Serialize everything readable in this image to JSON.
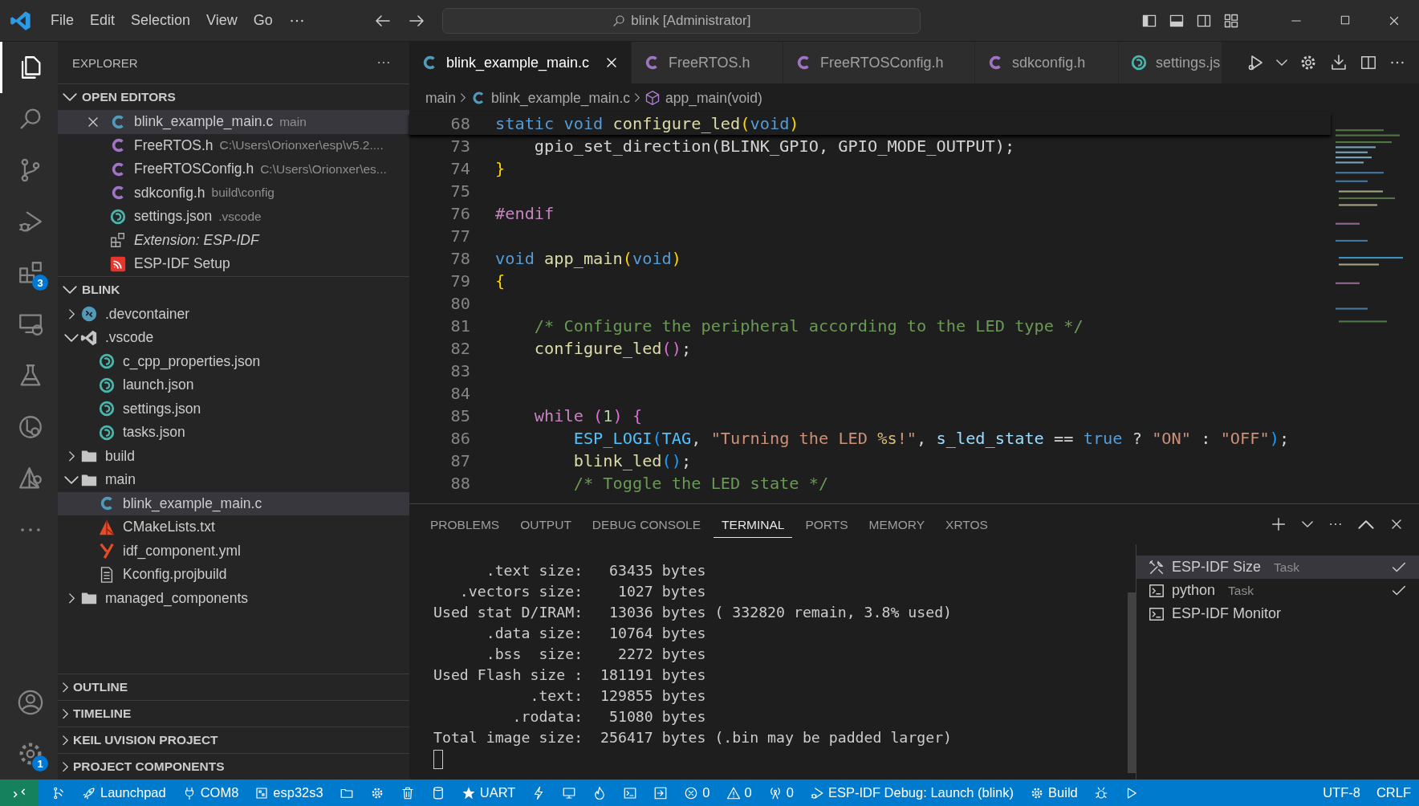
{
  "title_bar": {
    "menu": [
      {
        "label": "File"
      },
      {
        "label": "Edit"
      },
      {
        "label": "Selection"
      },
      {
        "label": "View"
      },
      {
        "label": "Go"
      }
    ],
    "search": {
      "value": "blink [Administrator]"
    }
  },
  "activity_bar": {
    "items": [
      {
        "kind": "files",
        "selected": true
      },
      {
        "kind": "search",
        "selected": false
      },
      {
        "kind": "branch",
        "selected": false
      },
      {
        "kind": "debug",
        "selected": false
      },
      {
        "kind": "extensions",
        "selected": false,
        "badge": "3"
      },
      {
        "kind": "remote",
        "selected": false
      },
      {
        "kind": "flask",
        "selected": false
      },
      {
        "kind": "circle-search",
        "selected": false
      },
      {
        "kind": "pyramid",
        "selected": false
      },
      {
        "kind": "more",
        "selected": false
      }
    ],
    "bottom": [
      {
        "kind": "account"
      },
      {
        "kind": "settings",
        "badge": "1"
      }
    ]
  },
  "sidebar": {
    "title": "EXPLORER",
    "sections": [
      {
        "title": "OPEN EDITORS",
        "expanded": true,
        "items": [
          {
            "name": "blink_example_main.c",
            "detail": "main",
            "kind": "c",
            "selected": true
          },
          {
            "name": "FreeRTOS.h",
            "detail": "C:\\Users\\Orionxer\\esp\\v5.2....",
            "kind": "h",
            "selected": false
          },
          {
            "name": "FreeRTOSConfig.h",
            "detail": "C:\\Users\\Orionxer\\es...",
            "kind": "h",
            "selected": false
          },
          {
            "name": "sdkconfig.h",
            "detail": "build\\config",
            "kind": "h",
            "selected": false
          },
          {
            "name": "settings.json",
            "detail": ".vscode",
            "kind": "json",
            "selected": false
          },
          {
            "name": "Extension: ESP-IDF",
            "kind": "extension",
            "selected": false
          },
          {
            "name": "ESP-IDF Setup",
            "kind": "esp",
            "selected": false
          }
        ]
      },
      {
        "title": "BLINK",
        "expanded": true,
        "items": [
          {
            "name": ".devcontainer",
            "kind": "devcontainer",
            "expanded": false,
            "selected": false
          },
          {
            "name": ".vscode",
            "kind": "vscode",
            "expanded": true,
            "selected": false,
            "children": [
              {
                "name": "c_cpp_properties.json",
                "kind": "json",
                "selected": false
              },
              {
                "name": "launch.json",
                "kind": "json",
                "selected": false
              },
              {
                "name": "settings.json",
                "kind": "json",
                "selected": false
              },
              {
                "name": "tasks.json",
                "kind": "json",
                "selected": false
              }
            ]
          },
          {
            "name": "build",
            "kind": "folder",
            "expanded": false,
            "selected": false
          },
          {
            "name": "main",
            "kind": "folder",
            "expanded": true,
            "selected": false,
            "children": [
              {
                "name": "blink_example_main.c",
                "kind": "c",
                "selected": true
              },
              {
                "name": "CMakeLists.txt",
                "kind": "cmake",
                "selected": false
              },
              {
                "name": "idf_component.yml",
                "kind": "yaml",
                "selected": false
              },
              {
                "name": "Kconfig.projbuild",
                "kind": "file",
                "selected": false
              }
            ]
          },
          {
            "name": "managed_components",
            "kind": "folder",
            "expanded": false,
            "selected": false
          }
        ]
      },
      {
        "title": "OUTLINE",
        "expanded": false
      },
      {
        "title": "TIMELINE",
        "expanded": false
      },
      {
        "title": "KEIL UVISION PROJECT",
        "expanded": false
      },
      {
        "title": "PROJECT COMPONENTS",
        "expanded": false
      }
    ]
  },
  "tabs": [
    {
      "label": "blink_example_main.c",
      "kind": "c",
      "selected": true
    },
    {
      "label": "FreeRTOS.h",
      "kind": "h",
      "selected": false
    },
    {
      "label": "FreeRTOSConfig.h",
      "kind": "h",
      "selected": false
    },
    {
      "label": "sdkconfig.h",
      "kind": "h",
      "selected": false
    },
    {
      "label": "settings.js",
      "kind": "json",
      "selected": false
    }
  ],
  "breadcrumb": [
    {
      "label": "main",
      "kind": "folder"
    },
    {
      "label": "blink_example_main.c",
      "kind": "c"
    },
    {
      "label": "app_main(void)",
      "kind": "symbol"
    }
  ],
  "editor": {
    "sticky": {
      "number": "68",
      "tokens": [
        {
          "kind": "keyword",
          "text": "static void "
        },
        {
          "kind": "function",
          "text": "configure_led"
        },
        {
          "kind": "bracket1",
          "text": "("
        },
        {
          "kind": "keyword",
          "text": "void"
        },
        {
          "kind": "bracket1",
          "text": ")"
        }
      ]
    },
    "lines": [
      {
        "number": "73",
        "tokens": [
          {
            "kind": "plain",
            "text": "    gpio_set_direction(BLINK_GPIO, GPIO_MODE_OUTPUT);"
          }
        ]
      },
      {
        "number": "74",
        "tokens": [
          {
            "kind": "bracket1",
            "text": "}"
          }
        ]
      },
      {
        "number": "75"
      },
      {
        "number": "76",
        "tokens": [
          {
            "kind": "preprocessor",
            "text": "#endif"
          }
        ]
      },
      {
        "number": "77"
      },
      {
        "number": "78",
        "tokens": [
          {
            "kind": "keyword",
            "text": "void "
          },
          {
            "kind": "function",
            "text": "app_main"
          },
          {
            "kind": "bracket1",
            "text": "("
          },
          {
            "kind": "keyword",
            "text": "void"
          },
          {
            "kind": "bracket1",
            "text": ")"
          }
        ]
      },
      {
        "number": "79",
        "tokens": [
          {
            "kind": "bracket1",
            "text": "{"
          }
        ]
      },
      {
        "number": "80"
      },
      {
        "number": "81",
        "tokens": [
          {
            "kind": "comment",
            "text": "    /* Configure the peripheral according to the LED type */"
          }
        ]
      },
      {
        "number": "82",
        "tokens": [
          {
            "kind": "function",
            "text": "    configure_led"
          },
          {
            "kind": "bracket2",
            "text": "()"
          },
          {
            "kind": "plain",
            "text": ";"
          }
        ]
      },
      {
        "number": "83"
      },
      {
        "number": "84"
      },
      {
        "number": "85",
        "tokens": [
          {
            "kind": "control",
            "text": "    while "
          },
          {
            "kind": "bracket2",
            "text": "("
          },
          {
            "kind": "number",
            "text": "1"
          },
          {
            "kind": "bracket2",
            "text": ") {"
          }
        ]
      },
      {
        "number": "86",
        "tokens": [
          {
            "kind": "macro",
            "text": "        ESP_LOGI"
          },
          {
            "kind": "bracket3",
            "text": "("
          },
          {
            "kind": "macro",
            "text": "TAG"
          },
          {
            "kind": "plain",
            "text": ", "
          },
          {
            "kind": "string",
            "text": "\"Turning the LED "
          },
          {
            "kind": "escape",
            "text": "%s"
          },
          {
            "kind": "string",
            "text": "!\""
          },
          {
            "kind": "plain",
            "text": ", "
          },
          {
            "kind": "variable",
            "text": "s_led_state"
          },
          {
            "kind": "plain",
            "text": " == "
          },
          {
            "kind": "keyword",
            "text": "true"
          },
          {
            "kind": "plain",
            "text": " ? "
          },
          {
            "kind": "string",
            "text": "\"ON\""
          },
          {
            "kind": "plain",
            "text": " : "
          },
          {
            "kind": "string",
            "text": "\"OFF\""
          },
          {
            "kind": "bracket3",
            "text": ")"
          },
          {
            "kind": "plain",
            "text": ";"
          }
        ]
      },
      {
        "number": "87",
        "tokens": [
          {
            "kind": "function",
            "text": "        blink_led"
          },
          {
            "kind": "bracket3",
            "text": "()"
          },
          {
            "kind": "plain",
            "text": ";"
          }
        ]
      },
      {
        "number": "88",
        "tokens": [
          {
            "kind": "comment",
            "text": "        /* Toggle the LED state */"
          }
        ]
      }
    ]
  },
  "panel": {
    "tabs": [
      {
        "label": "PROBLEMS",
        "selected": false
      },
      {
        "label": "OUTPUT",
        "selected": false
      },
      {
        "label": "DEBUG CONSOLE",
        "selected": false
      },
      {
        "label": "TERMINAL",
        "selected": true
      },
      {
        "label": "PORTS",
        "selected": false
      },
      {
        "label": "MEMORY",
        "selected": false
      },
      {
        "label": "XRTOS",
        "selected": false
      }
    ],
    "terminal_lines": [
      "      .text size:   63435 bytes",
      "   .vectors size:    1027 bytes",
      "Used stat D/IRAM:   13036 bytes ( 332820 remain, 3.8% used)",
      "      .data size:   10764 bytes",
      "      .bss  size:    2272 bytes",
      "Used Flash size :  181191 bytes",
      "           .text:  129855 bytes",
      "         .rodata:   51080 bytes",
      "Total image size:  256417 bytes (.bin may be padded larger)"
    ],
    "terminals": [
      {
        "name": "ESP-IDF Size",
        "detail": "Task",
        "kind": "tools",
        "done": true,
        "selected": true
      },
      {
        "name": "python",
        "detail": "Task",
        "kind": "terminal",
        "done": true,
        "selected": false
      },
      {
        "name": "ESP-IDF Monitor",
        "kind": "terminal",
        "done": false,
        "selected": false
      }
    ]
  },
  "status_bar": {
    "items": [
      {
        "kind": "fork"
      },
      {
        "kind": "rocket",
        "text": "Launchpad"
      },
      {
        "kind": "plug",
        "text": "COM8"
      },
      {
        "kind": "chip",
        "text": "esp32s3"
      },
      {
        "kind": "folder"
      },
      {
        "kind": "gear"
      },
      {
        "kind": "trash"
      },
      {
        "kind": "database"
      },
      {
        "kind": "star",
        "text": "UART"
      },
      {
        "kind": "bolt"
      },
      {
        "kind": "monitor"
      },
      {
        "kind": "flame"
      },
      {
        "kind": "terminal"
      },
      {
        "kind": "arrow-box"
      },
      {
        "kind": "error",
        "text": "0"
      },
      {
        "kind": "warning",
        "text": "0"
      },
      {
        "kind": "antenna",
        "text": "0"
      },
      {
        "kind": "debug",
        "text": "ESP-IDF Debug: Launch (blink)"
      },
      {
        "kind": "gear",
        "text": "Build"
      },
      {
        "kind": "bug"
      },
      {
        "kind": "play"
      }
    ],
    "right": [
      {
        "text": "UTF-8"
      },
      {
        "text": "CRLF"
      }
    ]
  }
}
